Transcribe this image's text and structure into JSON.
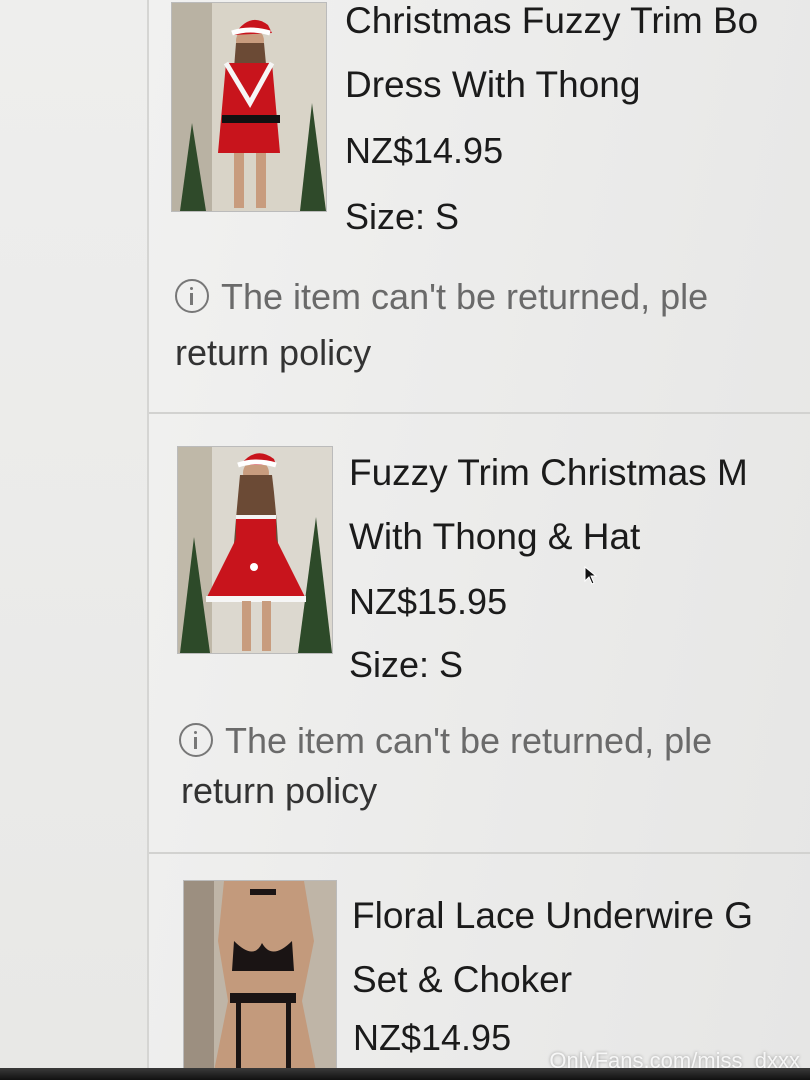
{
  "items": [
    {
      "title_line1": "Christmas Fuzzy Trim Bo",
      "title_line2": "Dress With Thong",
      "price": "NZ$14.95",
      "size": "Size: S",
      "notice": "The item can't be returned, ple",
      "policy": "return policy"
    },
    {
      "title_line1": "Fuzzy Trim Christmas M",
      "title_line2": "With Thong & Hat",
      "price": "NZ$15.95",
      "size": "Size: S",
      "notice": "The item can't be returned, ple",
      "policy": "return policy"
    },
    {
      "title_line1": "Floral Lace Underwire G",
      "title_line2": "Set & Choker",
      "price": "NZ$14.95"
    }
  ],
  "watermark": "OnlyFans.com/miss_dxxx",
  "colors": {
    "accent_red": "#c8141c",
    "text": "#1b1b1b",
    "muted": "#6a6a6a"
  }
}
